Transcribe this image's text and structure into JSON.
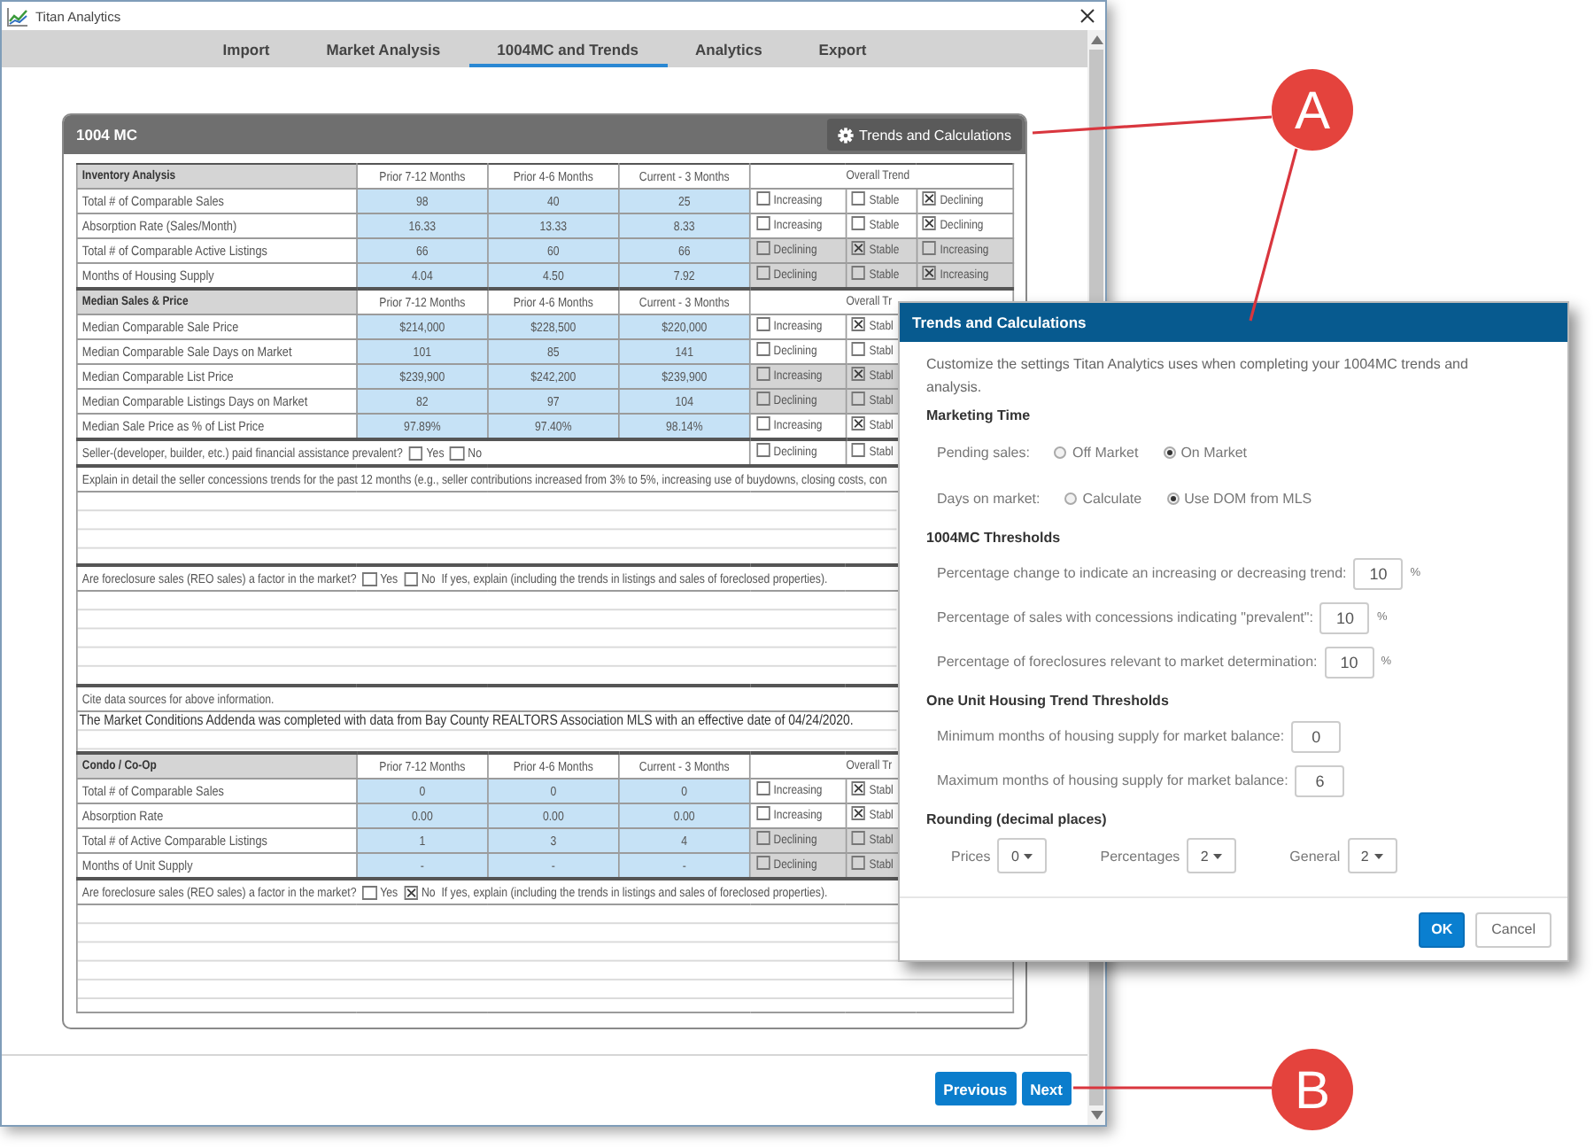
{
  "window": {
    "title": "Titan Analytics"
  },
  "tabs": [
    {
      "label": "Import",
      "selected": false
    },
    {
      "label": "Market Analysis",
      "selected": false
    },
    {
      "label": "1004MC and Trends",
      "selected": true
    },
    {
      "label": "Analytics",
      "selected": false
    },
    {
      "label": "Export",
      "selected": false
    }
  ],
  "panel": {
    "title": "1004 MC",
    "button": "Trends and Calculations"
  },
  "table": {
    "blocks": [
      {
        "kind": "grid",
        "title": "Inventory Analysis",
        "columns": [
          "Prior 7-12 Months",
          "Prior 4-6 Months",
          "Current - 3 Months"
        ],
        "trend_header": "Overall Trend",
        "rows": [
          {
            "label": "Total # of Comparable Sales",
            "values": [
              "98",
              "40",
              "25"
            ],
            "shaded": false,
            "trends": [
              {
                "label": "Increasing",
                "checked": false
              },
              {
                "label": "Stable",
                "checked": false
              },
              {
                "label": "Declining",
                "checked": true
              }
            ]
          },
          {
            "label": "Absorption Rate (Sales/Month)",
            "values": [
              "16.33",
              "13.33",
              "8.33"
            ],
            "shaded": false,
            "trends": [
              {
                "label": "Increasing",
                "checked": false
              },
              {
                "label": "Stable",
                "checked": false
              },
              {
                "label": "Declining",
                "checked": true
              }
            ]
          },
          {
            "label": "Total # of Comparable Active Listings",
            "values": [
              "66",
              "60",
              "66"
            ],
            "shaded": true,
            "trends": [
              {
                "label": "Declining",
                "checked": false
              },
              {
                "label": "Stable",
                "checked": true
              },
              {
                "label": "Increasing",
                "checked": false
              }
            ]
          },
          {
            "label": "Months of Housing Supply",
            "values": [
              "4.04",
              "4.50",
              "7.92"
            ],
            "shaded": true,
            "trends": [
              {
                "label": "Declining",
                "checked": false
              },
              {
                "label": "Stable",
                "checked": false
              },
              {
                "label": "Increasing",
                "checked": true
              }
            ]
          }
        ]
      },
      {
        "kind": "grid",
        "title": "Median Sales & Price",
        "columns": [
          "Prior 7-12 Months",
          "Prior 4-6 Months",
          "Current - 3 Months"
        ],
        "trend_header": "Overall Tr",
        "rows": [
          {
            "label": "Median Comparable Sale Price",
            "values": [
              "$214,000",
              "$228,500",
              "$220,000"
            ],
            "shaded": false,
            "trends": [
              {
                "label": "Increasing",
                "checked": false
              },
              {
                "label": "Stabl",
                "checked": true
              }
            ]
          },
          {
            "label": "Median Comparable Sale Days on Market",
            "values": [
              "101",
              "85",
              "141"
            ],
            "shaded": false,
            "trends": [
              {
                "label": "Declining",
                "checked": false
              },
              {
                "label": "Stabl",
                "checked": false
              }
            ]
          },
          {
            "label": "Median Comparable List Price",
            "values": [
              "$239,900",
              "$242,200",
              "$239,900"
            ],
            "shaded": true,
            "trends": [
              {
                "label": "Increasing",
                "checked": false
              },
              {
                "label": "Stabl",
                "checked": true
              }
            ]
          },
          {
            "label": "Median Comparable Listings Days on Market",
            "values": [
              "82",
              "97",
              "104"
            ],
            "shaded": true,
            "trends": [
              {
                "label": "Declining",
                "checked": false
              },
              {
                "label": "Stabl",
                "checked": false
              }
            ]
          },
          {
            "label": "Median Sale Price as % of List Price",
            "values": [
              "97.89%",
              "97.40%",
              "98.14%"
            ],
            "shaded": false,
            "trends": [
              {
                "label": "Increasing",
                "checked": false
              },
              {
                "label": "Stabl",
                "checked": true
              }
            ]
          }
        ]
      },
      {
        "kind": "check_row",
        "text": "Seller-(developer, builder, etc.) paid financial assistance prevalent?",
        "options": [
          {
            "label": "Yes",
            "checked": false
          },
          {
            "label": "No",
            "checked": false
          }
        ],
        "shaded": false,
        "trends": [
          {
            "label": "Declining",
            "checked": false
          },
          {
            "label": "Stabl",
            "checked": false
          }
        ]
      },
      {
        "kind": "prompt",
        "text": "Explain in detail the seller concessions trends for the past 12 months (e.g., seller contributions increased from 3% to 5%, increasing use of buydowns, closing costs, con"
      },
      {
        "kind": "yes_no",
        "text": "Are foreclosure sales (REO sales) a factor in the market?",
        "options": [
          {
            "label": "Yes",
            "checked": false
          },
          {
            "label": "No",
            "checked": false
          }
        ],
        "note": "If yes, explain (including the trends in listings and sales of foreclosed properties)."
      },
      {
        "kind": "prompt",
        "text": "Cite data sources for above information.",
        "value": "The Market Conditions Addenda was completed with data from Bay County REALTORS Association MLS with an effective date of 04/24/2020."
      },
      {
        "kind": "grid",
        "title": "Condo / Co-Op",
        "columns": [
          "Prior 7-12 Months",
          "Prior 4-6 Months",
          "Current - 3 Months"
        ],
        "trend_header": "Overall Tr",
        "rows": [
          {
            "label": "Total # of Comparable Sales",
            "values": [
              "0",
              "0",
              "0"
            ],
            "shaded": false,
            "trends": [
              {
                "label": "Increasing",
                "checked": false
              },
              {
                "label": "Stabl",
                "checked": true
              }
            ]
          },
          {
            "label": "Absorption Rate",
            "values": [
              "0.00",
              "0.00",
              "0.00"
            ],
            "shaded": false,
            "trends": [
              {
                "label": "Increasing",
                "checked": false
              },
              {
                "label": "Stabl",
                "checked": true
              }
            ]
          },
          {
            "label": "Total # of Active Comparable Listings",
            "values": [
              "1",
              "3",
              "4"
            ],
            "shaded": true,
            "trends": [
              {
                "label": "Declining",
                "checked": false
              },
              {
                "label": "Stabl",
                "checked": false
              }
            ]
          },
          {
            "label": "Months of Unit Supply",
            "values": [
              "-",
              "-",
              "-"
            ],
            "shaded": true,
            "trends": [
              {
                "label": "Declining",
                "checked": false
              },
              {
                "label": "Stabl",
                "checked": false
              }
            ]
          }
        ]
      },
      {
        "kind": "yes_no",
        "text": "Are foreclosure sales (REO sales) a factor in the market?",
        "options": [
          {
            "label": "Yes",
            "checked": false
          },
          {
            "label": "No",
            "checked": true
          }
        ],
        "note": "If yes, explain (including the trends in listings and sales of foreclosed properties)."
      }
    ]
  },
  "nav": [
    {
      "label": "Previous"
    },
    {
      "label": "Next"
    }
  ],
  "dialog": {
    "title": "Trends and Calculations",
    "intro": "Customize the settings Titan Analytics uses when completing your 1004MC trends and analysis.",
    "groups": [
      {
        "heading": "Marketing Time",
        "rows": [
          {
            "kind": "radio",
            "label": "Pending sales:",
            "options": [
              {
                "label": "Off Market",
                "selected": false
              },
              {
                "label": "On Market",
                "selected": true
              }
            ]
          },
          {
            "kind": "radio",
            "label": "Days on market:",
            "options": [
              {
                "label": "Calculate",
                "selected": false
              },
              {
                "label": "Use DOM from MLS",
                "selected": true
              }
            ]
          }
        ]
      },
      {
        "heading": "1004MC Thresholds",
        "rows": [
          {
            "kind": "input",
            "label": "Percentage change to indicate an increasing or decreasing trend:",
            "value": "10",
            "unit": "%"
          },
          {
            "kind": "input",
            "label": "Percentage of sales with concessions indicating \"prevalent\":",
            "value": "10",
            "unit": "%"
          },
          {
            "kind": "input",
            "label": "Percentage of foreclosures relevant to market determination:",
            "value": "10",
            "unit": "%"
          }
        ]
      },
      {
        "heading": "One Unit Housing Trend Thresholds",
        "rows": [
          {
            "kind": "input",
            "label": "Minimum months of housing supply for market balance:",
            "value": "0"
          },
          {
            "kind": "input",
            "label": "Maximum months of housing supply for market balance:",
            "value": "6"
          }
        ]
      },
      {
        "heading": "Rounding (decimal places)",
        "rows": [
          {
            "kind": "selects",
            "items": [
              {
                "label": "Prices",
                "value": "0"
              },
              {
                "label": "Percentages",
                "value": "2"
              },
              {
                "label": "General",
                "value": "2"
              }
            ]
          }
        ]
      }
    ],
    "buttons": [
      {
        "label": "OK",
        "kind": "primary"
      },
      {
        "label": "Cancel",
        "kind": "secondary"
      }
    ]
  },
  "callouts": [
    {
      "label": "A"
    },
    {
      "label": "B"
    }
  ]
}
